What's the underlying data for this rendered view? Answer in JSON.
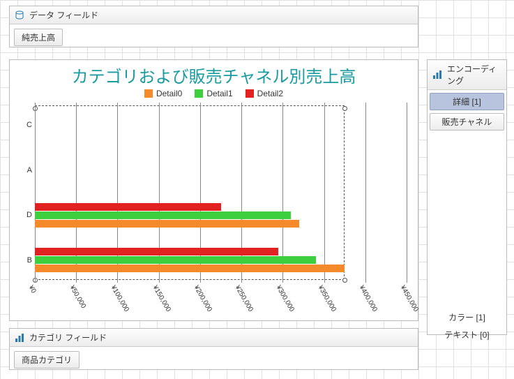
{
  "panels": {
    "data_fields": {
      "title": "データ フィールド",
      "chip": "純売上高"
    },
    "category_fields": {
      "title": "カテゴリ フィールド",
      "chip": "商品カテゴリ"
    },
    "encoding": {
      "title": "エンコーディング",
      "detail_chip": "詳細 [1]",
      "channel_chip": "販売チャネル",
      "color_chip": "カラー [1]",
      "text_chip": "テキスト [0]"
    }
  },
  "chart_data": {
    "type": "bar",
    "orientation": "horizontal",
    "title": "カテゴリおよび販売チャネル別売上高",
    "xlabel": "",
    "ylabel": "",
    "categories": [
      "C",
      "A",
      "D",
      "B"
    ],
    "series": [
      {
        "name": "Detail0",
        "color": "#f58a2a",
        "values": [
          0,
          0,
          320000,
          375000
        ]
      },
      {
        "name": "Detail1",
        "color": "#3ecf3e",
        "values": [
          0,
          0,
          310000,
          340000
        ]
      },
      {
        "name": "Detail2",
        "color": "#e22222",
        "values": [
          0,
          0,
          225000,
          295000
        ]
      }
    ],
    "xlim": [
      0,
      450000
    ],
    "xticks": [
      0,
      50000,
      100000,
      150000,
      200000,
      250000,
      300000,
      350000,
      400000,
      450000
    ],
    "xtick_labels": [
      "¥0",
      "¥50,000",
      "¥100,000",
      "¥150,000",
      "¥200,000",
      "¥250,000",
      "¥300,000",
      "¥350,000",
      "¥400,000",
      "¥450,000"
    ]
  }
}
